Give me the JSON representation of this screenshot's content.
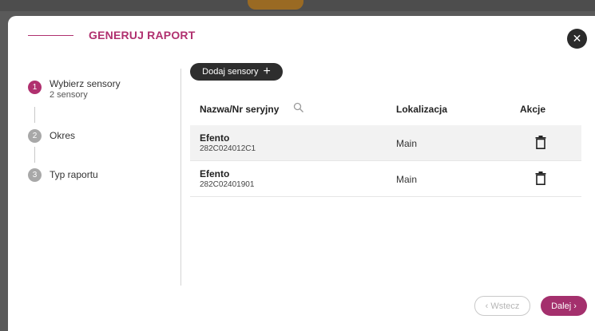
{
  "modal": {
    "title": "GENERUJ RAPORT",
    "close_label": "✕"
  },
  "steps": [
    {
      "number": "1",
      "label": "Wybierz sensory",
      "sub": "2 sensory",
      "active": true
    },
    {
      "number": "2",
      "label": "Okres",
      "active": false
    },
    {
      "number": "3",
      "label": "Typ raportu",
      "active": false
    }
  ],
  "add_button": {
    "label": "Dodaj sensory",
    "icon": "plus-icon",
    "plus": "+"
  },
  "table": {
    "headers": {
      "name": "Nazwa/Nr seryjny",
      "location": "Lokalizacja",
      "actions": "Akcje"
    },
    "rows": [
      {
        "name": "Efento",
        "serial": "282C024012C1",
        "location": "Main",
        "action_icon": "trash-icon"
      },
      {
        "name": "Efento",
        "serial": "282C02401901",
        "location": "Main",
        "action_icon": "trash-icon"
      }
    ]
  },
  "footer": {
    "back_label": "‹ Wstecz",
    "next_label": "Dalej ›"
  },
  "colors": {
    "accent": "#b0306f",
    "dark": "#2e2e2e",
    "row_shade": "#f2f2f2",
    "next_button": "#a4306d"
  }
}
